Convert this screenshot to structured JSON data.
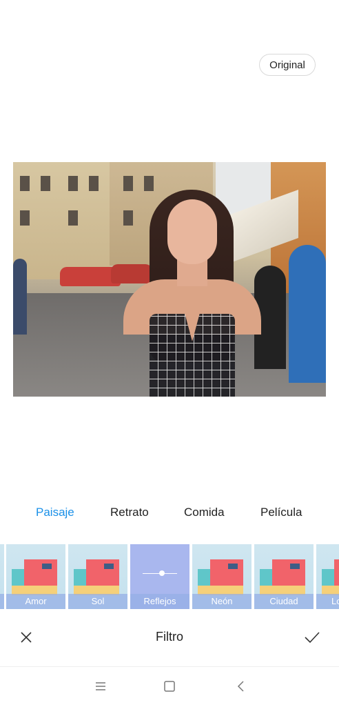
{
  "toolbar": {
    "original_label": "Original"
  },
  "categories": [
    {
      "label": "Paisaje",
      "active": true
    },
    {
      "label": "Retrato",
      "active": false
    },
    {
      "label": "Comida",
      "active": false
    },
    {
      "label": "Película",
      "active": false
    }
  ],
  "filters": [
    {
      "label": ""
    },
    {
      "label": "Amor"
    },
    {
      "label": "Sol"
    },
    {
      "label": "Reflejos",
      "selected": true
    },
    {
      "label": "Neón"
    },
    {
      "label": "Ciudad"
    },
    {
      "label": "Lo"
    }
  ],
  "bottom_bar": {
    "title": "Filtro",
    "cancel_icon": "close-icon",
    "confirm_icon": "check-icon"
  },
  "nav_bar": {
    "icons": [
      "menu-icon",
      "home-icon",
      "back-icon"
    ]
  },
  "colors": {
    "accent": "#1a90e8",
    "filter_selected": "#a9b7ee"
  }
}
